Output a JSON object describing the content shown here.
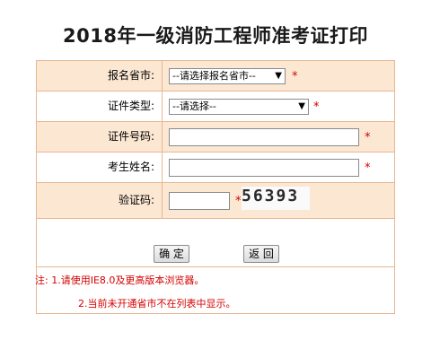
{
  "page_title": "2018年一级消防工程师准考证打印",
  "form": {
    "province": {
      "label": "报名省市:",
      "value": "--请选择报名省市--",
      "required": "*"
    },
    "id_type": {
      "label": "证件类型:",
      "value": "--请选择--",
      "required": "*"
    },
    "id_number": {
      "label": "证件号码:",
      "value": "",
      "required": "*"
    },
    "name": {
      "label": "考生姓名:",
      "value": "",
      "required": "*"
    },
    "captcha": {
      "label": "验证码:",
      "value": "",
      "required": "*",
      "image_text": "56393"
    }
  },
  "buttons": {
    "confirm": "确 定",
    "back": "返 回"
  },
  "notes": {
    "note1": "注: 1.请使用IE8.0及更高版本浏览器。",
    "note2": "2.当前未开通省市不在列表中显示。"
  },
  "colors": {
    "row_shade": "#fce7d2",
    "border": "#e6b894",
    "required": "#d40000"
  }
}
